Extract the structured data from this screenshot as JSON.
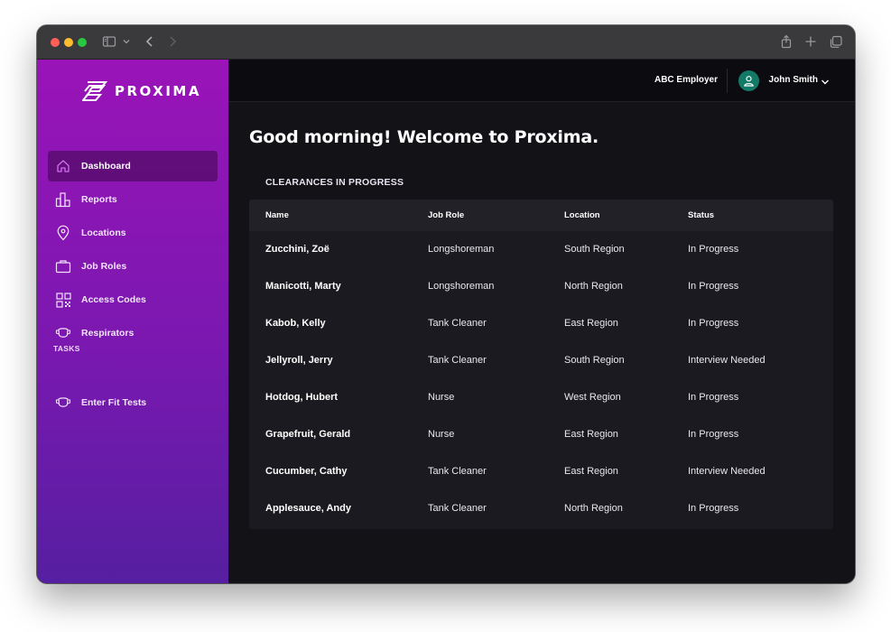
{
  "app": {
    "brand": "PROXIMA",
    "employer": "ABC Employer",
    "user_name": "John Smith"
  },
  "colors": {
    "sidebar_top": "#9a14b8",
    "sidebar_bottom": "#561fa1",
    "avatar": "#137a68",
    "background": "#131217"
  },
  "sidebar": {
    "items": [
      {
        "label": "Dashboard",
        "icon": "home-icon",
        "active": true
      },
      {
        "label": "Reports",
        "icon": "bar-chart-icon"
      },
      {
        "label": "Locations",
        "icon": "map-pin-icon"
      },
      {
        "label": "Job Roles",
        "icon": "briefcase-icon"
      },
      {
        "label": "Access Codes",
        "icon": "qr-code-icon"
      },
      {
        "label": "Respirators",
        "icon": "respirator-icon"
      }
    ],
    "tasks_label": "TASKS",
    "tasks": [
      {
        "label": "Enter Fit Tests",
        "icon": "respirator-icon"
      }
    ]
  },
  "main": {
    "greeting": "Good morning! Welcome to Proxima.",
    "card_title": "CLEARANCES IN PROGRESS",
    "columns": [
      "Name",
      "Job Role",
      "Location",
      "Status"
    ],
    "rows": [
      [
        "Zucchini, Zoë",
        "Longshoreman",
        "South Region",
        "In Progress"
      ],
      [
        "Manicotti, Marty",
        "Longshoreman",
        "North Region",
        "In Progress"
      ],
      [
        "Kabob, Kelly",
        "Tank Cleaner",
        "East Region",
        "In Progress"
      ],
      [
        "Jellyroll, Jerry",
        "Tank Cleaner",
        "South Region",
        "Interview Needed"
      ],
      [
        "Hotdog, Hubert",
        "Nurse",
        "West Region",
        "In Progress"
      ],
      [
        "Grapefruit, Gerald",
        "Nurse",
        "East Region",
        "In Progress"
      ],
      [
        "Cucumber, Cathy",
        "Tank Cleaner",
        "East Region",
        "Interview Needed"
      ],
      [
        "Applesauce, Andy",
        "Tank Cleaner",
        "North Region",
        "In Progress"
      ]
    ]
  }
}
